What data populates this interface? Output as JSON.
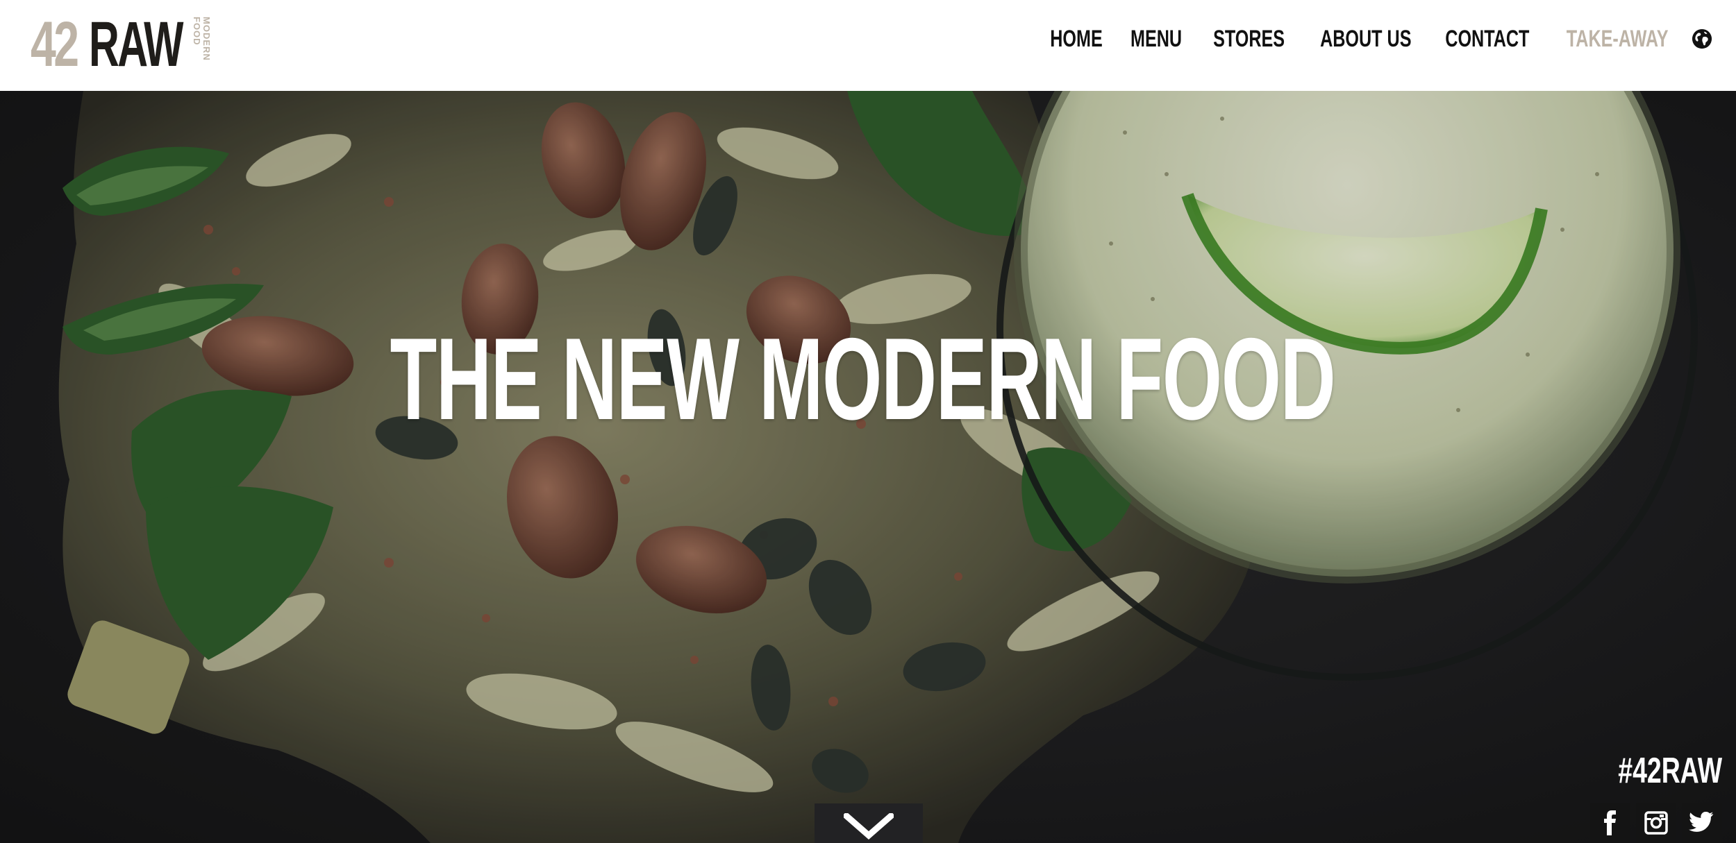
{
  "logo": {
    "number": "42",
    "word": "RAW",
    "tagline": "MODERN FOOD"
  },
  "nav": {
    "items": [
      {
        "label": "HOME"
      },
      {
        "label": "MENU"
      },
      {
        "label": "STORES"
      },
      {
        "label": "ABOUT US"
      },
      {
        "label": "CONTACT"
      },
      {
        "label": "TAKE-AWAY"
      }
    ],
    "language_icon": "globe-icon"
  },
  "hero": {
    "title": "THE NEW MODERN FOOD",
    "image": "salad-and-lemon-drink-photo",
    "hashtag": "#42RAW",
    "scroll_icon": "chevron-down-icon"
  },
  "social": {
    "icons": [
      "facebook-icon",
      "instagram-icon",
      "twitter-icon"
    ]
  },
  "colors": {
    "header_bg": "#ffffff",
    "nav_text": "#111111",
    "nav_muted": "#bdb3a6",
    "logo_accent": "#bdb3a6",
    "logo_dark": "#1f1d1a",
    "hero_bg": "#1c1c1e",
    "hero_text": "#ffffff",
    "button_bg": "#141414"
  }
}
